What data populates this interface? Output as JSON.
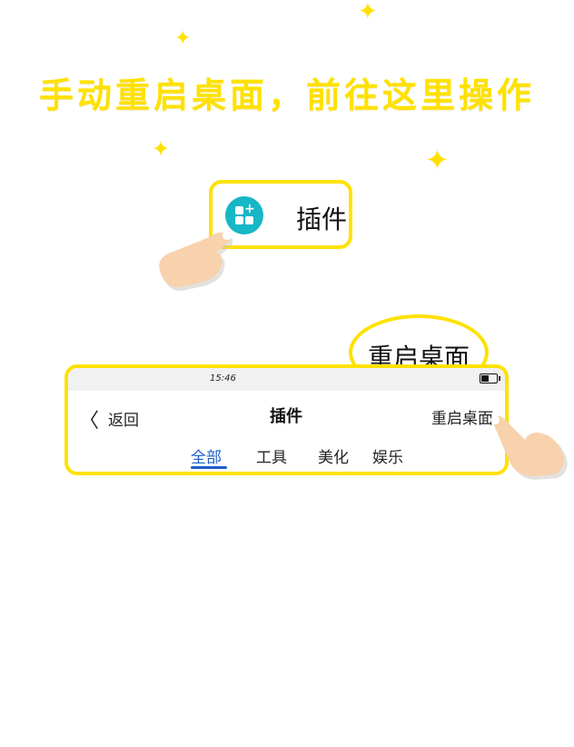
{
  "headline": "手动重启桌面，前往这里操作",
  "plugin_entry": {
    "label": "插件",
    "icon": "plugin-grid-plus-icon"
  },
  "callout": {
    "label": "重启桌面"
  },
  "screen": {
    "status_time": "15:46",
    "nav": {
      "back_label": "返回",
      "title": "插件",
      "restart_label": "重启桌面"
    },
    "tabs": [
      {
        "label": "全部",
        "active": true
      },
      {
        "label": "工具",
        "active": false
      },
      {
        "label": "美化",
        "active": false
      },
      {
        "label": "娱乐",
        "active": false
      }
    ]
  },
  "colors": {
    "accent": "#ffe100",
    "icon_bg": "#17b7c6",
    "active_tab": "#1e5fc8"
  }
}
